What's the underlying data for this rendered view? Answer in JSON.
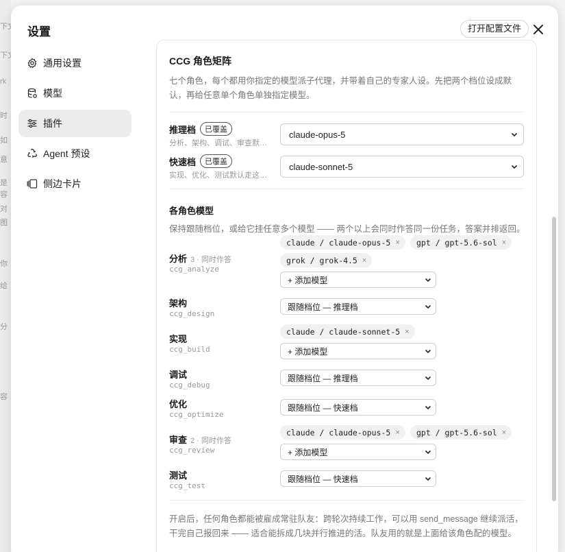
{
  "dialog": {
    "title": "设置",
    "open_config_label": "打开配置文件"
  },
  "nav": {
    "items": [
      {
        "label": "通用设置",
        "icon": "gear-icon"
      },
      {
        "label": "模型",
        "icon": "database-icon"
      },
      {
        "label": "插件",
        "icon": "sliders-icon",
        "active": true
      },
      {
        "label": "Agent 预设",
        "icon": "recycle-icon"
      },
      {
        "label": "侧边卡片",
        "icon": "cards-icon"
      }
    ]
  },
  "section": {
    "title": "CCG 角色矩阵",
    "desc": "七个角色，每个都用你指定的模型派子代理，并带着自己的专家人设。先把两个档位设成默认，再给任意单个角色单独指定模型。"
  },
  "tiers": [
    {
      "label": "推理档",
      "badge": "已覆盖",
      "sub": "分析、架构、调试、审查默认走这一档",
      "value": "claude-opus-5"
    },
    {
      "label": "快速档",
      "badge": "已覆盖",
      "sub": "实现、优化、测试默认走这一档",
      "value": "claude-sonnet-5"
    }
  ],
  "roles_section": {
    "title": "各角色模型",
    "desc": "保持跟随档位，或给它挂任意多个模型 —— 两个以上会同时作答同一份任务，答案并排返回。"
  },
  "roles": [
    {
      "name": "分析",
      "meta": "3 · 同时作答",
      "id": "ccg_analyze",
      "chips": [
        "claude / claude-opus-5",
        "gpt / gpt-5.6-sol",
        "grok / grok-4.5"
      ],
      "select": "+ 添加模型"
    },
    {
      "name": "架构",
      "meta": "",
      "id": "ccg_design",
      "chips": [],
      "select": "跟随档位 — 推理档"
    },
    {
      "name": "实现",
      "meta": "",
      "id": "ccg_build",
      "chips": [
        "claude / claude-sonnet-5"
      ],
      "select": "+ 添加模型"
    },
    {
      "name": "调试",
      "meta": "",
      "id": "ccg_debug",
      "chips": [],
      "select": "跟随档位 — 推理档"
    },
    {
      "name": "优化",
      "meta": "",
      "id": "ccg_optimize",
      "chips": [],
      "select": "跟随档位 — 快速档"
    },
    {
      "name": "审查",
      "meta": "2 · 同时作答",
      "id": "ccg_review",
      "chips": [
        "claude / claude-opus-5",
        "gpt / gpt-5.6-sol"
      ],
      "select": "+ 添加模型"
    },
    {
      "name": "测试",
      "meta": "",
      "id": "ccg_test",
      "chips": [],
      "select": "跟随档位 — 快速档"
    }
  ],
  "chip_remove": "×",
  "footer": "开启后，任何角色都能被雇成常驻队友：跨轮次持续工作，可以用 send_message 继续派活，干完自己报回来 —— 适合能拆成几块并行推进的活。队友用的就是上面给该角色配的模型。",
  "background_glyphs": [
    "下文",
    "下文",
    "rk",
    "时",
    "如",
    "意",
    "是",
    "容",
    "对",
    "图",
    "你",
    "给",
    "分",
    "容"
  ]
}
